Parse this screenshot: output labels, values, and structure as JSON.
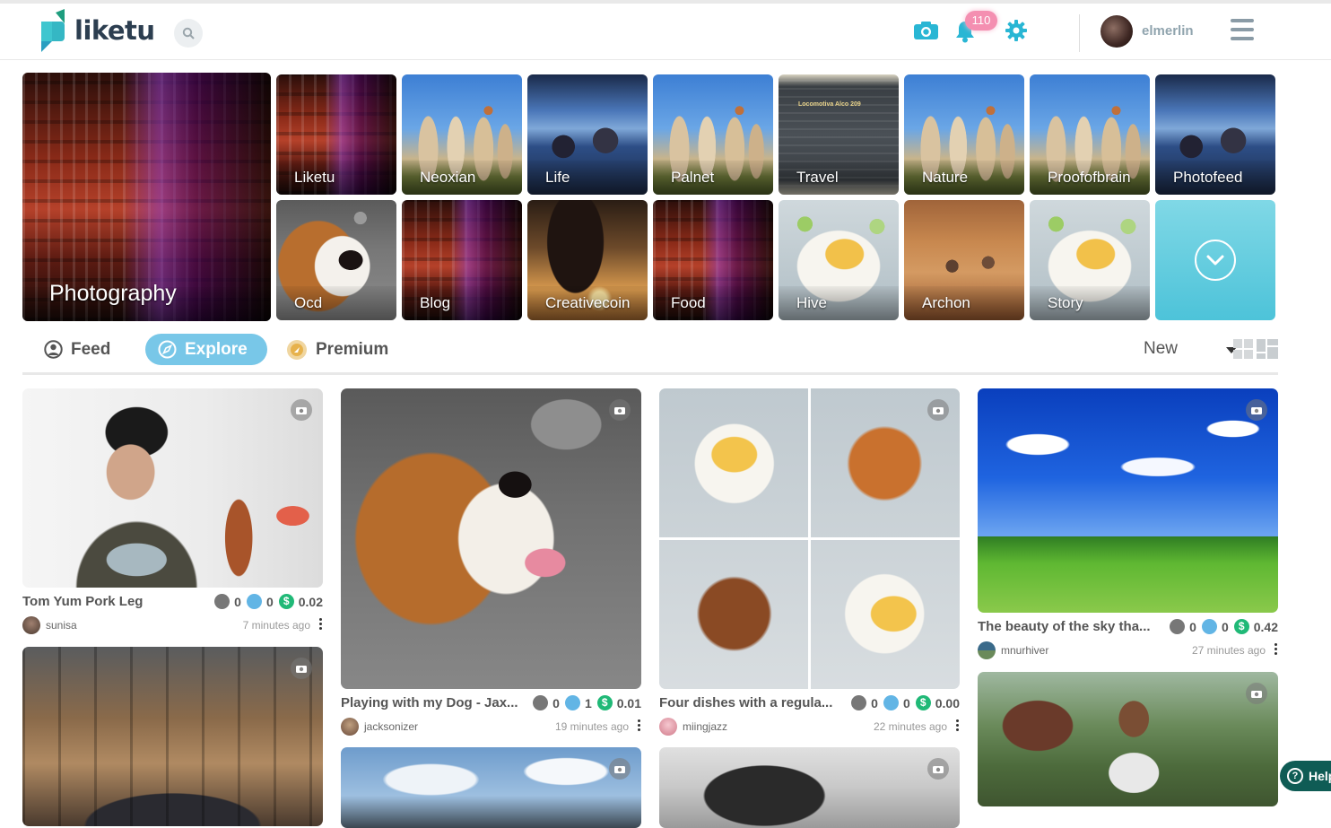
{
  "header": {
    "brand": "liketu",
    "notifications_count": "110",
    "username": "elmerlin"
  },
  "tags": [
    {
      "label": "Photography",
      "image": "city-night"
    },
    {
      "label": "Liketu",
      "image": "city-night"
    },
    {
      "label": "Neoxian",
      "image": "rock-formations"
    },
    {
      "label": "Life",
      "image": "bus-interior"
    },
    {
      "label": "Palnet",
      "image": "rock-formations"
    },
    {
      "label": "Travel",
      "image": "sign-plaque"
    },
    {
      "label": "Nature",
      "image": "rock-formations"
    },
    {
      "label": "Proofofbrain",
      "image": "rock-formations"
    },
    {
      "label": "Photofeed",
      "image": "bus-interior"
    },
    {
      "label": "Ocd",
      "image": "dog"
    },
    {
      "label": "Blog",
      "image": "city-night"
    },
    {
      "label": "Creativecoin",
      "image": "sunset"
    },
    {
      "label": "Food",
      "image": "city-night"
    },
    {
      "label": "Hive",
      "image": "food-plate"
    },
    {
      "label": "Archon",
      "image": "workers"
    },
    {
      "label": "Story",
      "image": "food-plate"
    }
  ],
  "sign_text": "Locomotiva Alco 209",
  "tabs": {
    "feed": "Feed",
    "explore": "Explore",
    "premium": "Premium"
  },
  "sort": {
    "selected": "New"
  },
  "posts": [
    {
      "title": "Tom Yum Pork Leg",
      "likes": "0",
      "comments": "0",
      "payout": "0.02",
      "author": "sunisa",
      "time": "7 minutes ago"
    },
    {
      "title": "Playing with my Dog - Jax...",
      "likes": "0",
      "comments": "1",
      "payout": "0.01",
      "author": "jacksonizer",
      "time": "19 minutes ago"
    },
    {
      "title": "Four dishes with a regula...",
      "likes": "0",
      "comments": "0",
      "payout": "0.00",
      "author": "miingjazz",
      "time": "22 minutes ago"
    },
    {
      "title": "The beauty of the sky tha...",
      "likes": "0",
      "comments": "0",
      "payout": "0.42",
      "author": "mnurhiver",
      "time": "27 minutes ago"
    }
  ],
  "help": {
    "label": "Help",
    "icon": "question-icon"
  },
  "colors": {
    "accent": "#4dc3d9",
    "explore_tab": "#78c7e8",
    "badge": "#f48fb1",
    "payout": "#20b977",
    "comment": "#62b5e5"
  }
}
